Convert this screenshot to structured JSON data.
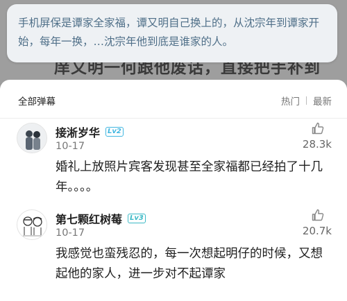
{
  "background": {
    "subtitle": "庠又明一何跟他废话，直接把手补到"
  },
  "quote": {
    "text": "手机屏保是谭家全家福，谭又明自己换上的，从沈宗年到谭家开始，每年一换，…沈宗年他到底是谁家的人。"
  },
  "panel": {
    "title": "全部弹幕",
    "sort_hot": "热门",
    "sort_latest": "最新"
  },
  "comments": [
    {
      "username": "接淅岁华",
      "level": "Lv2",
      "date": "10-17",
      "likes": "28.3k",
      "text": "婚礼上放照片宾客发现甚至全家福都已经拍了十几年。。。。"
    },
    {
      "username": "第七颗红树莓",
      "level": "Lv3",
      "date": "10-17",
      "likes": "20.7k",
      "text": "我感觉也蛮残忍的，每一次想起明仔的时候，又想起他的家人，进一步对不起谭家"
    }
  ],
  "colors": {
    "quote_text": "#4f6f88",
    "level_badge": "#40b6e0"
  }
}
